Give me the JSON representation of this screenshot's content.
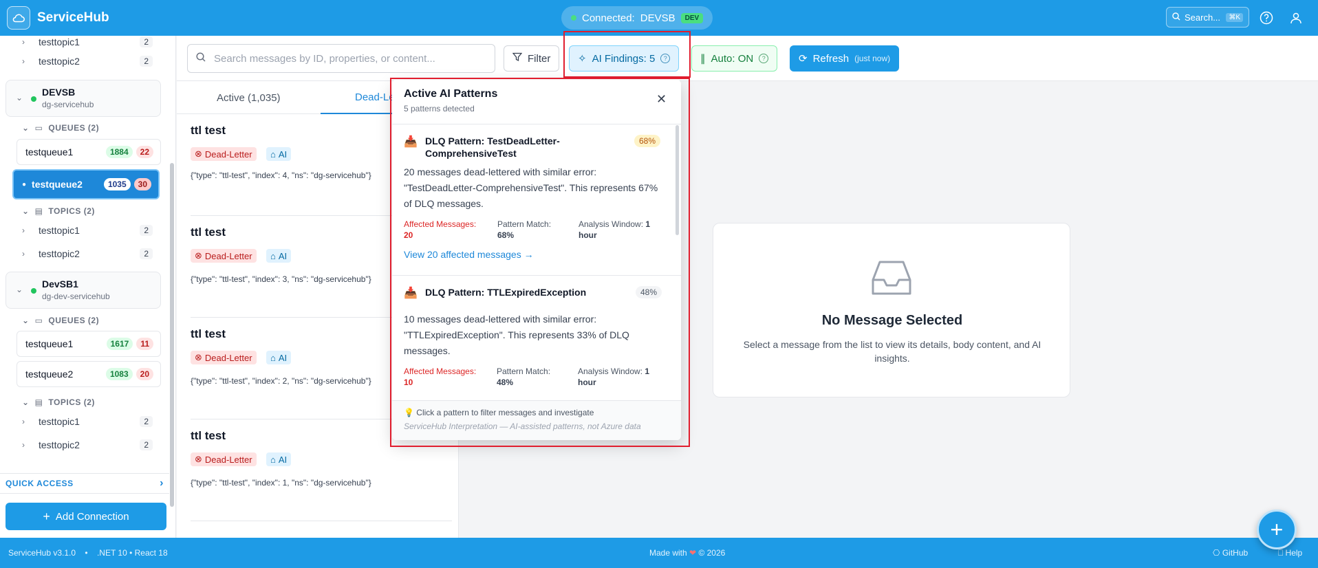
{
  "app": {
    "name": "ServiceHub"
  },
  "header": {
    "connection_label": "Connected:",
    "connection_name": "DEVSB",
    "env_badge": "DEV",
    "search_label": "Search...",
    "search_shortcut": "⌘K"
  },
  "sidebar": {
    "top_topics": [
      {
        "name": "testtopic1",
        "count": "2"
      },
      {
        "name": "testtopic2",
        "count": "2"
      }
    ],
    "namespaces": [
      {
        "name": "DEVSB",
        "sub": "dg-servicehub",
        "queues_header": "QUEUES (2)",
        "queues": [
          {
            "name": "testqueue1",
            "active": "1884",
            "dead": "22"
          },
          {
            "name": "testqueue2",
            "active": "1035",
            "dead": "30"
          }
        ],
        "topics_header": "TOPICS (2)",
        "topics": [
          {
            "name": "testtopic1",
            "count": "2"
          },
          {
            "name": "testtopic2",
            "count": "2"
          }
        ]
      },
      {
        "name": "DevSB1",
        "sub": "dg-dev-servicehub",
        "queues_header": "QUEUES (2)",
        "queues": [
          {
            "name": "testqueue1",
            "active": "1617",
            "dead": "11"
          },
          {
            "name": "testqueue2",
            "active": "1083",
            "dead": "20"
          }
        ],
        "topics_header": "TOPICS (2)",
        "topics": [
          {
            "name": "testtopic1",
            "count": "2"
          },
          {
            "name": "testtopic2",
            "count": "2"
          }
        ]
      }
    ],
    "quick_access": "QUICK ACCESS",
    "add_connection": "Add Connection"
  },
  "toolbar": {
    "search_placeholder": "Search messages by ID, properties, or content...",
    "filter": "Filter",
    "ai_findings": "AI Findings: 5",
    "auto": "Auto: ON",
    "refresh": "Refresh",
    "refresh_time": "(just now)"
  },
  "tabs": {
    "active": "Active (1,035)",
    "dead": "Dead-Letter"
  },
  "messages": [
    {
      "title": "ttl test",
      "status": "Dead-Letter",
      "ai": "AI",
      "body": "{\"type\": \"ttl-test\", \"index\": 4, \"ns\": \"dg-servicehub\"}"
    },
    {
      "title": "ttl test",
      "status": "Dead-Letter",
      "ai": "AI",
      "body": "{\"type\": \"ttl-test\", \"index\": 3, \"ns\": \"dg-servicehub\"}"
    },
    {
      "title": "ttl test",
      "status": "Dead-Letter",
      "ai": "AI",
      "body": "{\"type\": \"ttl-test\", \"index\": 2, \"ns\": \"dg-servicehub\"}"
    },
    {
      "title": "ttl test",
      "status": "Dead-Letter",
      "ai": "AI",
      "body": "{\"type\": \"ttl-test\", \"index\": 1, \"ns\": \"dg-servicehub\"}"
    }
  ],
  "popover": {
    "title": "Active AI Patterns",
    "subtitle": "5 patterns detected",
    "patterns": [
      {
        "title": "DLQ Pattern: TestDeadLetter-ComprehensiveTest",
        "pct": "68%",
        "desc": "20 messages dead-lettered with similar error: \"TestDeadLetter-ComprehensiveTest\". This represents 67% of DLQ messages.",
        "affected_label": "Affected Messages:",
        "affected": "20",
        "match_label": "Pattern Match:",
        "match": "68%",
        "window_label": "Analysis Window:",
        "window": "1 hour",
        "link": "View 20 affected messages →"
      },
      {
        "title": "DLQ Pattern: TTLExpiredException",
        "pct": "48%",
        "desc": "10 messages dead-lettered with similar error: \"TTLExpiredException\". This represents 33% of DLQ messages.",
        "affected_label": "Affected Messages:",
        "affected": "10",
        "match_label": "Pattern Match:",
        "match": "48%",
        "window_label": "Analysis Window:",
        "window": "1 hour"
      }
    ],
    "footer_hint": "💡 Click a pattern to filter messages and investigate",
    "footer_note": "ServiceHub Interpretation — AI-assisted patterns, not Azure data"
  },
  "detail": {
    "empty_title": "No Message Selected",
    "empty_sub": "Select a message from the list to view its details, body content, and AI insights."
  },
  "footer": {
    "version": "ServiceHub v3.1.0",
    "sep": "•",
    "stack": ".NET 10 • React 18",
    "made_with": "Made with",
    "heart": "❤",
    "year": "© 2026",
    "github": "GitHub",
    "help": "Help"
  }
}
